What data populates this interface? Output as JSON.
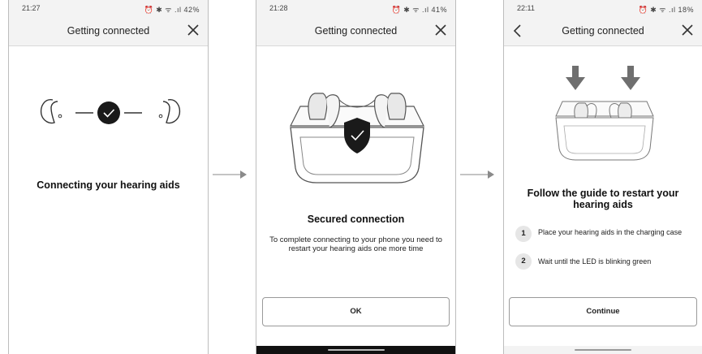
{
  "screens": [
    {
      "status_time": "21:27",
      "status_right": "⏰ ✱ ᯤ .ıl 42%",
      "title": "Getting connected",
      "heading": "Connecting your hearing aids"
    },
    {
      "status_time": "21:28",
      "status_right": "⏰ ✱ ᯤ .ıl 41%",
      "title": "Getting connected",
      "heading": "Secured connection",
      "body": "To complete connecting to your phone you need to restart your hearing aids one more time",
      "button": "OK"
    },
    {
      "status_time": "22:11",
      "status_right": "⏰ ✱ ᯤ .ıl 18%",
      "title": "Getting connected",
      "heading": "Follow the guide to restart your hearing aids",
      "steps": [
        {
          "number": "1",
          "text": "Place your hearing aids in the charging case"
        },
        {
          "number": "2",
          "text": "Wait until the LED is blinking green"
        }
      ],
      "button": "Continue"
    }
  ],
  "icons": [
    "close-icon",
    "back-chevron-icon",
    "check-icon",
    "shield-check-icon",
    "down-arrow-icon",
    "flow-arrow-icon"
  ],
  "colors": {
    "appbar": "#f3f3f3",
    "badge": "#1a1a1a",
    "arrow": "#7a7a7a"
  }
}
